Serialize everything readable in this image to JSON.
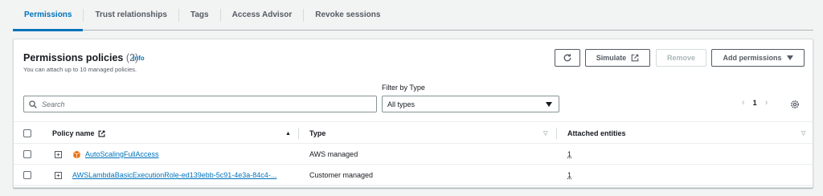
{
  "tabs": [
    {
      "label": "Permissions",
      "active": true
    },
    {
      "label": "Trust relationships"
    },
    {
      "label": "Tags"
    },
    {
      "label": "Access Advisor"
    },
    {
      "label": "Revoke sessions"
    }
  ],
  "panel": {
    "title": "Permissions policies",
    "count": "(2)",
    "info": "Info",
    "description": "You can attach up to 10 managed policies."
  },
  "buttons": {
    "refresh_icon": "refresh-icon",
    "simulate": "Simulate",
    "simulate_icon": "external-link-icon",
    "remove": "Remove",
    "add_permissions": "Add permissions"
  },
  "filter": {
    "label": "Filter by Type",
    "search_placeholder": "Search",
    "search_value": "",
    "type_selected": "All types"
  },
  "pagination": {
    "current_page": "1"
  },
  "table": {
    "columns": {
      "policy_name": "Policy name",
      "type": "Type",
      "attached_entities": "Attached entities"
    },
    "rows": [
      {
        "name": "AutoScalingFullAccess",
        "type": "AWS managed",
        "entities": "1",
        "icon": "aws-managed-cube-icon"
      },
      {
        "name": "AWSLambdaBasicExecutionRole-ed139ebb-5c91-4e3a-84c4-...",
        "type": "Customer managed",
        "entities": "1"
      }
    ]
  },
  "colors": {
    "accent": "#0073bb",
    "aws_managed_icon": "#ec7211"
  }
}
